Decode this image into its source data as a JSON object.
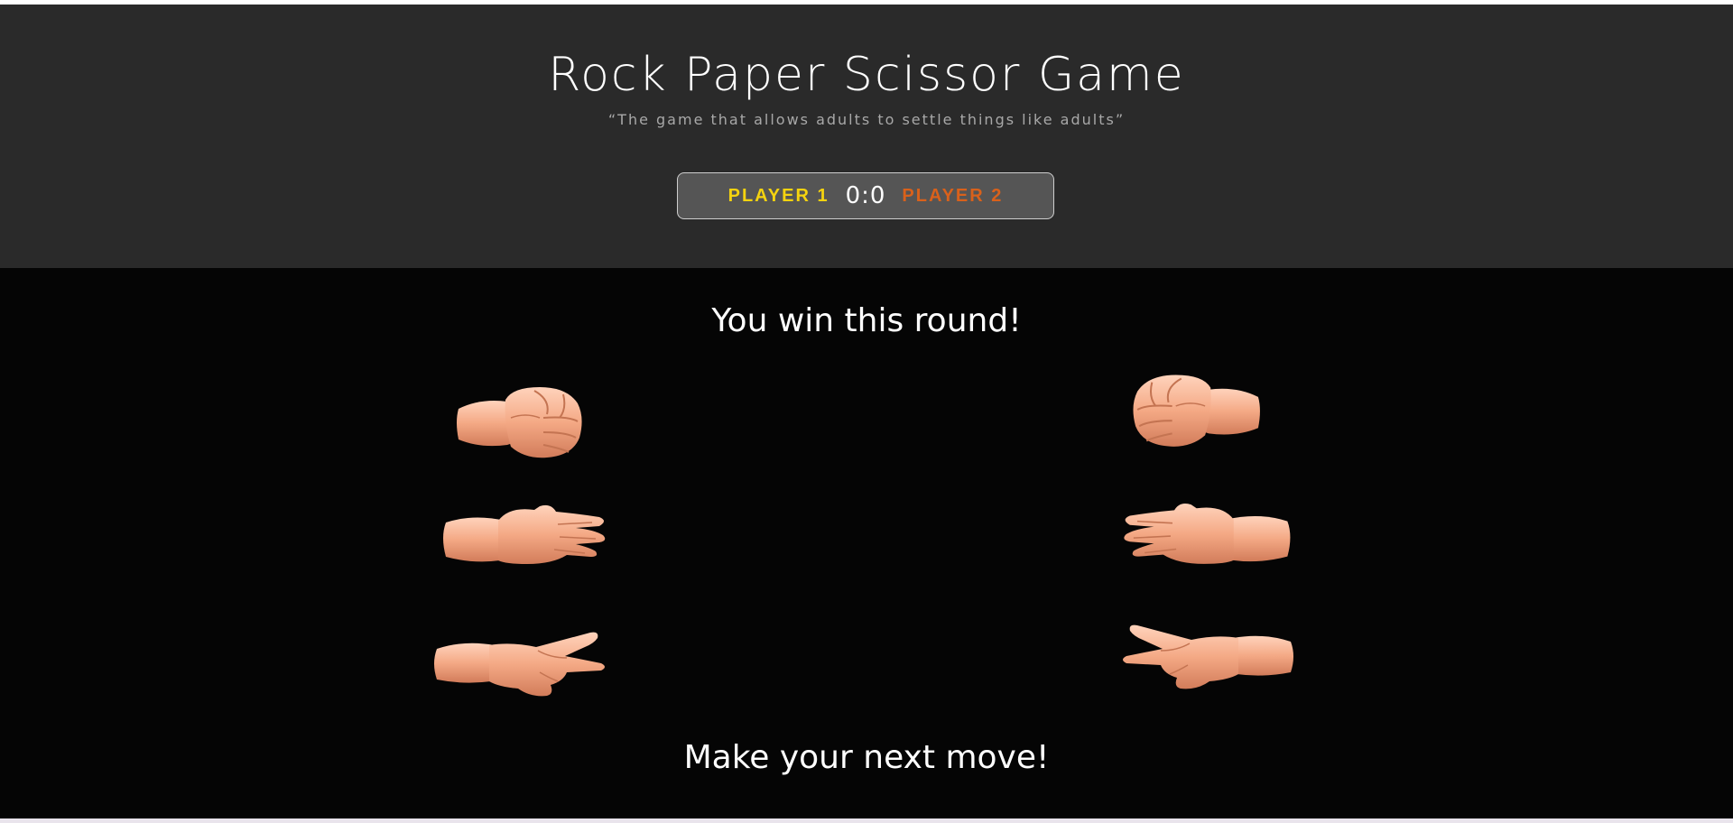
{
  "header": {
    "title": "Rock Paper Scissor Game",
    "subtitle": "“The game that allows adults to settle things like adults”"
  },
  "scoreboard": {
    "player1_label": "PLAYER 1",
    "score": "0:0",
    "player2_label": "PLAYER 2",
    "player1_color": "#f5d30f",
    "player2_color": "#d9611b"
  },
  "arena": {
    "result_message": "You win this round!",
    "prompt_message": "Make your next move!"
  },
  "choices": {
    "player1": [
      "rock",
      "paper",
      "scissors"
    ],
    "player2": [
      "rock",
      "paper",
      "scissors"
    ]
  },
  "colors": {
    "header_bg": "#2a2a2a",
    "arena_bg": "#050505",
    "skin": "#f2a886"
  }
}
